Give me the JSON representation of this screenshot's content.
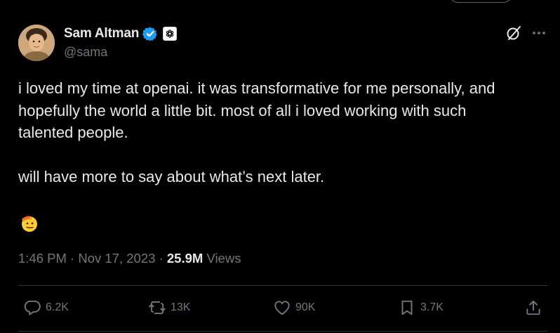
{
  "author": {
    "name": "Sam Altman",
    "handle": "@sama"
  },
  "tweet": {
    "paragraphs": [
      "i loved my time at openai. it was transformative for me personally, and\nhopefully the world a little bit. most of all i loved working with such\ntalented people.",
      "will have more to say about what’s next later."
    ],
    "emoji": "saluting-face-emoji"
  },
  "meta": {
    "time": "1:46 PM",
    "separator": "·",
    "date": "Nov 17, 2023",
    "views_count": "25.9M",
    "views_label": "Views"
  },
  "actions": {
    "replies": "6.2K",
    "reposts": "13K",
    "likes": "90K",
    "bookmarks": "3.7K"
  },
  "icons": {
    "verified": "verified-badge-icon",
    "org": "openai-logo-icon",
    "grok": "grok-icon",
    "more": "more-icon",
    "reply": "reply-icon",
    "repost": "repost-icon",
    "like": "heart-icon",
    "bookmark": "bookmark-icon",
    "share": "share-icon"
  },
  "colors": {
    "background": "#000000",
    "text": "#e7e9ea",
    "muted": "#71767b",
    "verified": "#1d9bf0",
    "divider": "#2f3336"
  }
}
